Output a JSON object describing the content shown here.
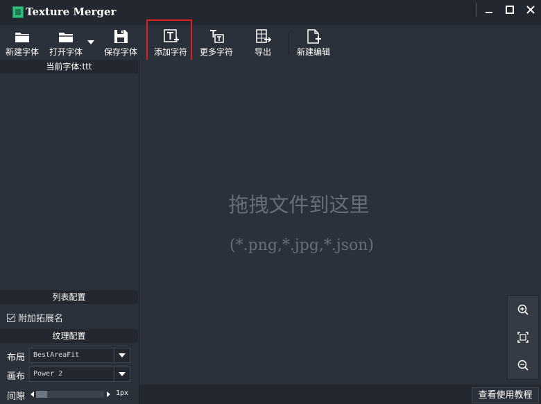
{
  "app": {
    "title": "Texture Merger"
  },
  "toolbar": {
    "new_font": "新建字体",
    "open_font": "打开字体",
    "save_font": "保存字体",
    "add_char": "添加字符",
    "more_chars": "更多字符",
    "export": "导出",
    "new_edit": "新建编辑"
  },
  "sidebar": {
    "current_font": "当前字体:ttt",
    "list_config": "列表配置",
    "append_ext_label": "附加拓展名",
    "append_ext_checked": true,
    "texture_config": "纹理配置",
    "layout_label": "布局",
    "layout_value": "BestAreaFit",
    "canvas_label": "画布",
    "canvas_value": "Power 2",
    "gap_label": "间隙",
    "gap_value": "1px"
  },
  "canvas": {
    "drop_title": "拖拽文件到这里",
    "drop_hint": "(*.png,*.jpg,*.json)"
  },
  "footer": {
    "tutorial_button": "查看使用教程"
  },
  "colors": {
    "background": "#2b313b",
    "panel_header": "#232830",
    "highlight": "#e02020"
  }
}
